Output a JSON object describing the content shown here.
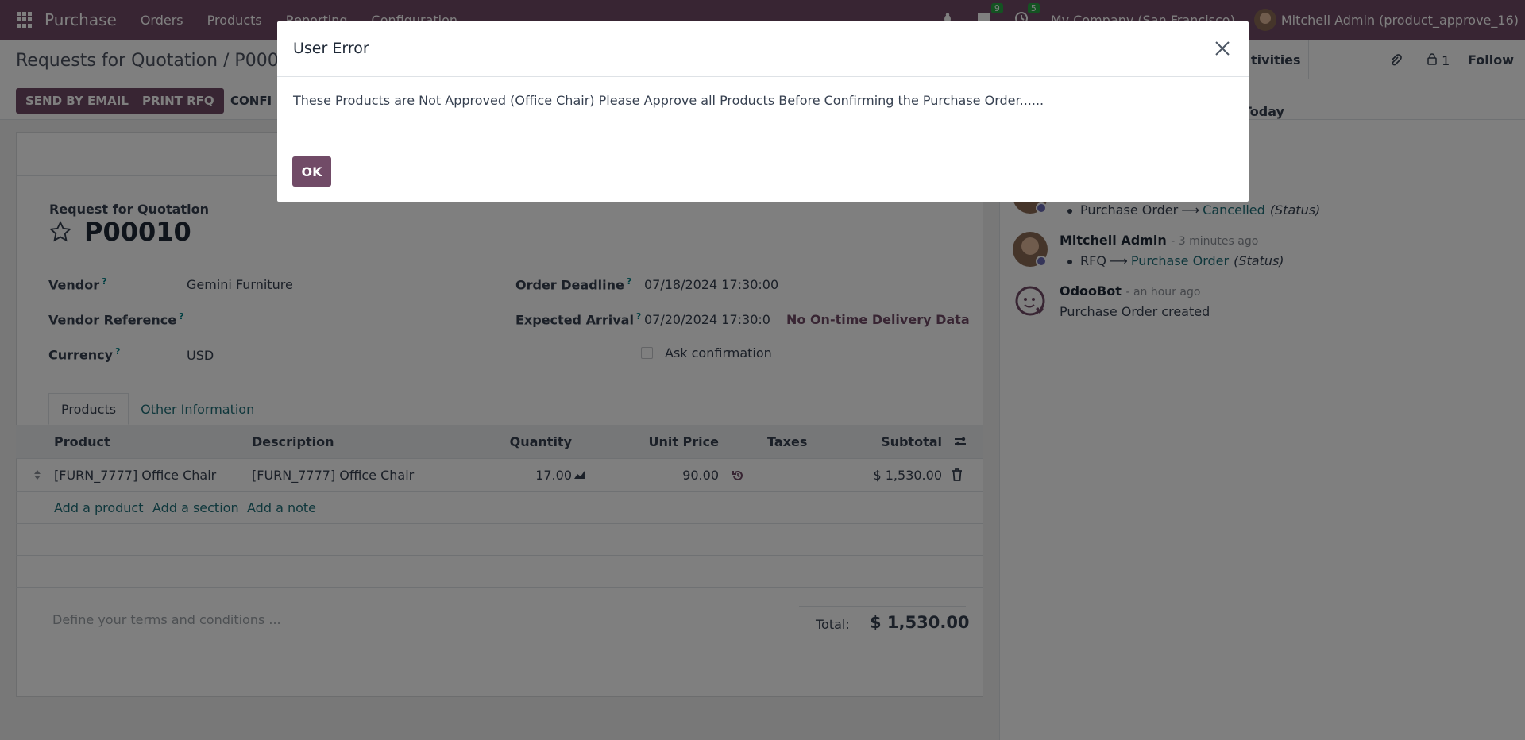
{
  "navbar": {
    "app_name": "Purchase",
    "menu": [
      "Orders",
      "Products",
      "Reporting",
      "Configuration"
    ],
    "messages_count": "9",
    "activities_count": "5",
    "company": "My Company (San Francisco)",
    "user": "Mitchell Admin (product_approve_16)"
  },
  "control": {
    "breadcrumb": "Requests for Quotation / P0001",
    "send_by_email": "SEND BY EMAIL",
    "print_rfq": "PRINT RFQ",
    "confirm": "CONFI",
    "activities": "tivities",
    "followers_count": "1",
    "follow": "Follow",
    "today": "Today"
  },
  "form": {
    "doc_label": "Request for Quotation",
    "name": "P00010",
    "vendor_label": "Vendor",
    "vendor": "Gemini Furniture",
    "vendor_ref_label": "Vendor Reference",
    "currency_label": "Currency",
    "currency": "USD",
    "deadline_label": "Order Deadline",
    "deadline": "07/18/2024 17:30:00",
    "arrival_label": "Expected Arrival",
    "arrival": "07/20/2024 17:30:0",
    "delivery_data": "No On-time Delivery Data",
    "ask_confirmation": "Ask confirmation",
    "help_mark": "?"
  },
  "tabs": [
    "Products",
    "Other Information"
  ],
  "table": {
    "headers": {
      "product": "Product",
      "description": "Description",
      "quantity": "Quantity",
      "unit_price": "Unit Price",
      "taxes": "Taxes",
      "subtotal": "Subtotal"
    },
    "rows": [
      {
        "product": "[FURN_7777] Office Chair",
        "description": "[FURN_7777] Office Chair",
        "quantity": "17.00",
        "unit_price": "90.00",
        "taxes": "",
        "subtotal": "$ 1,530.00"
      }
    ],
    "add_product": "Add a product",
    "add_section": "Add a section",
    "add_note": "Add a note"
  },
  "footer": {
    "terms_placeholder": "Define your terms and conditions ...",
    "total_label": "Total:",
    "total_value": "$ 1,530.00"
  },
  "chatter": {
    "messages": [
      {
        "author": "",
        "when": "",
        "field": "Purchase Order",
        "new_value": "Cancelled",
        "tracked": "(Status)"
      },
      {
        "author": "Mitchell Admin",
        "when": "- 3 minutes ago",
        "field": "RFQ",
        "new_value": "Purchase Order",
        "tracked": "(Status)"
      },
      {
        "author": "OdooBot",
        "when": "- an hour ago",
        "body": "Purchase Order created"
      }
    ]
  },
  "dialog": {
    "title": "User Error",
    "message": "These Products are Not Approved (Office Chair) Please Approve all Products Before Confirming the Purchase Order......",
    "ok": "OK"
  },
  "colors": {
    "brand": "#714b67",
    "link": "#1f6f78",
    "badge": "#28a745"
  }
}
